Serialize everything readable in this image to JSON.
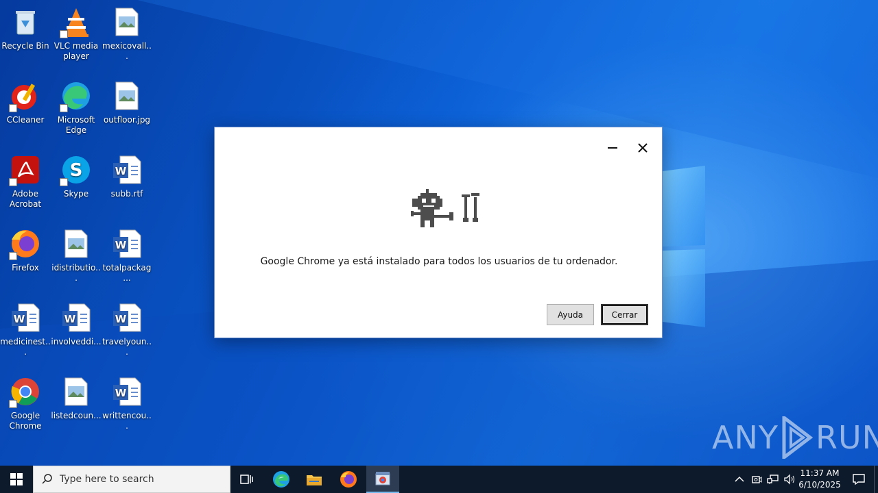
{
  "desktop": {
    "icons": [
      {
        "label": "Recycle Bin",
        "icon": "recycle-bin-icon"
      },
      {
        "label": "VLC media player",
        "icon": "vlc-icon"
      },
      {
        "label": "mexicovall...",
        "icon": "image-file-icon"
      },
      {
        "label": "CCleaner",
        "icon": "ccleaner-icon"
      },
      {
        "label": "Microsoft Edge",
        "icon": "edge-icon"
      },
      {
        "label": "outfloor.jpg",
        "icon": "image-file-icon"
      },
      {
        "label": "Adobe Acrobat",
        "icon": "acrobat-icon"
      },
      {
        "label": "Skype",
        "icon": "skype-icon"
      },
      {
        "label": "subb.rtf",
        "icon": "word-doc-icon"
      },
      {
        "label": "Firefox",
        "icon": "firefox-icon"
      },
      {
        "label": "idistributio...",
        "icon": "image-file-icon"
      },
      {
        "label": "totalpackag...",
        "icon": "word-doc-icon"
      },
      {
        "label": "medicinest...",
        "icon": "word-doc-icon"
      },
      {
        "label": "involveddi...",
        "icon": "word-doc-icon"
      },
      {
        "label": "travelyoun...",
        "icon": "word-doc-icon"
      },
      {
        "label": "Google Chrome",
        "icon": "chrome-icon"
      },
      {
        "label": "listedcoun...",
        "icon": "image-file-icon"
      },
      {
        "label": "writtencou...",
        "icon": "word-doc-icon"
      }
    ]
  },
  "dialog": {
    "message": "Google Chrome ya está instalado para todos los usuarios de tu ordenador.",
    "help_label": "Ayuda",
    "close_label": "Cerrar",
    "icon": "robot-tools-icon"
  },
  "watermark": {
    "left": "ANY",
    "right": "RUN"
  },
  "taskbar": {
    "search_placeholder": "Type here to search",
    "apps": [
      "task-view-icon",
      "edge-icon",
      "file-explorer-icon",
      "firefox-icon",
      "chrome-installer-icon"
    ],
    "clock_time": "11:37 AM",
    "clock_date": "6/10/2025"
  },
  "colors": {
    "taskbar": "#0d1a2b",
    "wallpaper_blue": "#0a5bd0",
    "button_face": "#e1e1e1"
  }
}
